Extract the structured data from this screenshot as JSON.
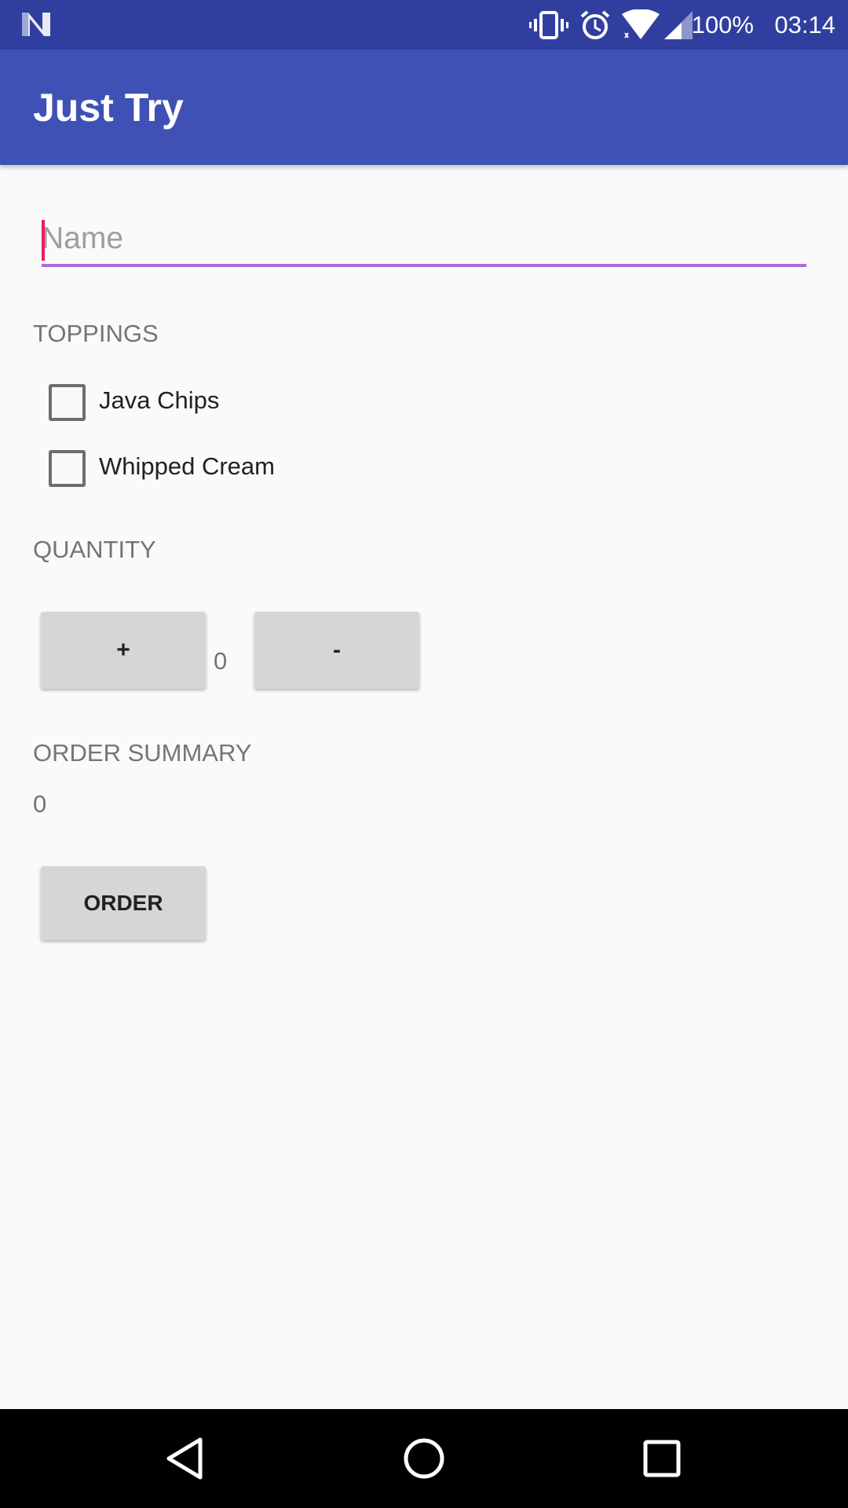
{
  "status_bar": {
    "battery": "100%",
    "time": "03:14",
    "icons": [
      "n-logo-icon",
      "vibrate-icon",
      "alarm-icon",
      "wifi-icon",
      "signal-icon"
    ]
  },
  "app_bar": {
    "title": "Just Try",
    "color": "#3f51b5"
  },
  "form": {
    "name_placeholder": "Name",
    "name_value": "",
    "toppings_header": "TOPPINGS",
    "toppings": [
      {
        "label": "Java Chips",
        "checked": false
      },
      {
        "label": "Whipped Cream",
        "checked": false
      }
    ],
    "quantity_header": "QUANTITY",
    "increment_label": "+",
    "decrement_label": "-",
    "quantity_value": "0",
    "summary_header": "ORDER SUMMARY",
    "summary_value": "0",
    "order_label": "ORDER"
  },
  "nav_bar": {
    "icons": [
      "back-icon",
      "home-icon",
      "recents-icon"
    ]
  },
  "colors": {
    "status_bar": "#303f9f",
    "accent": "#e91e63",
    "underline": "#ab6fd0"
  }
}
